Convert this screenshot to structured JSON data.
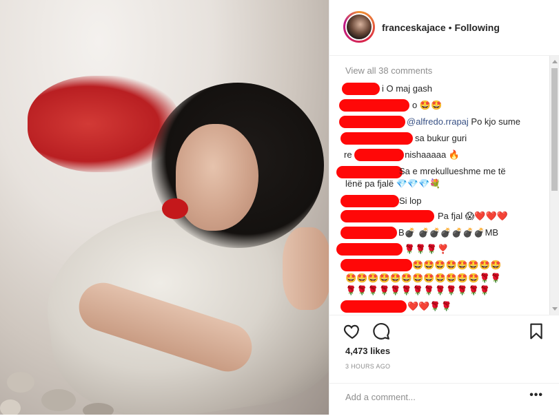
{
  "post": {
    "username": "franceskajace",
    "separator": "•",
    "follow_status": "Following"
  },
  "comments": {
    "view_all": "View all 38 comments",
    "items": [
      {
        "text": "i O maj gash"
      },
      {
        "text": "o 🤩🤩"
      },
      {
        "mention": "@alfredo.rrapaj",
        "text": " Po kjo sume"
      },
      {
        "text": "sa bukur guri"
      },
      {
        "prefix": "re",
        "text": "nishaaaaa 🔥"
      },
      {
        "text": "Sa e mrekullueshme me të",
        "line2": "lënë pa fjalë 💎💎💎💐"
      },
      {
        "text": "Si lop"
      },
      {
        "text": "Pa fjal 😱❤️❤️❤️"
      },
      {
        "text": "B💣 💣💣💣💣💣💣MB"
      },
      {
        "text": "🌹🌹🌹❣️"
      },
      {
        "text": "🤩🤩🤩🤩🤩🤩🤩🤩",
        "line2": "🤩🤩🤩🤩🤩🤩🤩🤩🤩🤩🤩🤩🌹🌹",
        "line3": "🌹🌹🌹🌹🌹🌹🌹🌹🌹🌹🌹🌹🌹"
      },
      {
        "text": "❤️❤️🌹🌹"
      }
    ]
  },
  "actions": {
    "likes": "4,473 likes",
    "time": "3 HOURS AGO",
    "comment_placeholder": "Add a comment...",
    "more": "•••"
  }
}
